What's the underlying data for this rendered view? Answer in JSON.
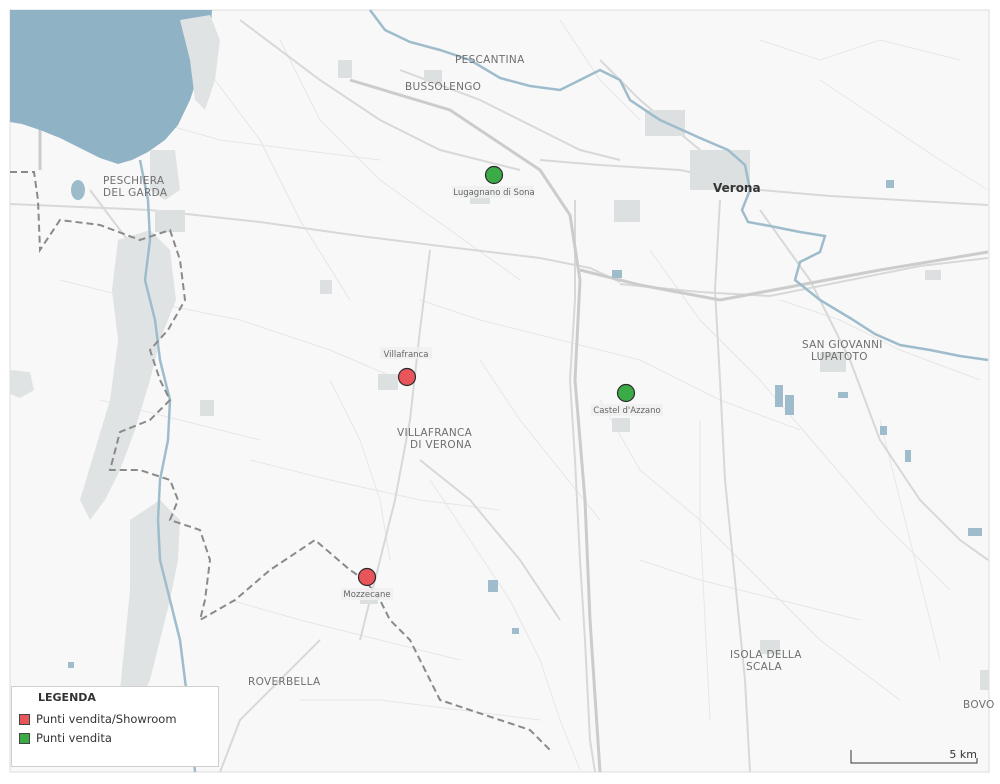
{
  "map": {
    "places": {
      "pescantina": "PESCANTINA",
      "bussolengo": "BUSSOLENGO",
      "peschiera_1": "PESCHIERA",
      "peschiera_2": "DEL GARDA",
      "verona": "Verona",
      "san_giovanni_1": "SAN GIOVANNI",
      "san_giovanni_2": "LUPATOTO",
      "villafranca_1": "VILLAFRANCA",
      "villafranca_2": "DI VERONA",
      "isola_1": "ISOLA DELLA",
      "isola_2": "SCALA",
      "roverbella": "ROVERBELLA",
      "bovolone": "BOVO"
    },
    "markers": [
      {
        "label": "Lugagnano di Sona",
        "category": "Punti vendita"
      },
      {
        "label": "Villafranca",
        "category": "Punti vendita/Showroom"
      },
      {
        "label": "Castel d'Azzano",
        "category": "Punti vendita"
      },
      {
        "label": "Mozzecane",
        "category": "Punti vendita/Showroom"
      }
    ],
    "scale_label": "5 km",
    "colors": {
      "water": "#8fb2c4",
      "land": "#f9f9f9",
      "showroom": "#e8555a",
      "store": "#3bab47"
    }
  },
  "legend": {
    "title": "LEGENDA",
    "items": [
      {
        "label": "Punti vendita/Showroom",
        "color": "#e8555a"
      },
      {
        "label": "Punti vendita",
        "color": "#3bab47"
      }
    ]
  }
}
